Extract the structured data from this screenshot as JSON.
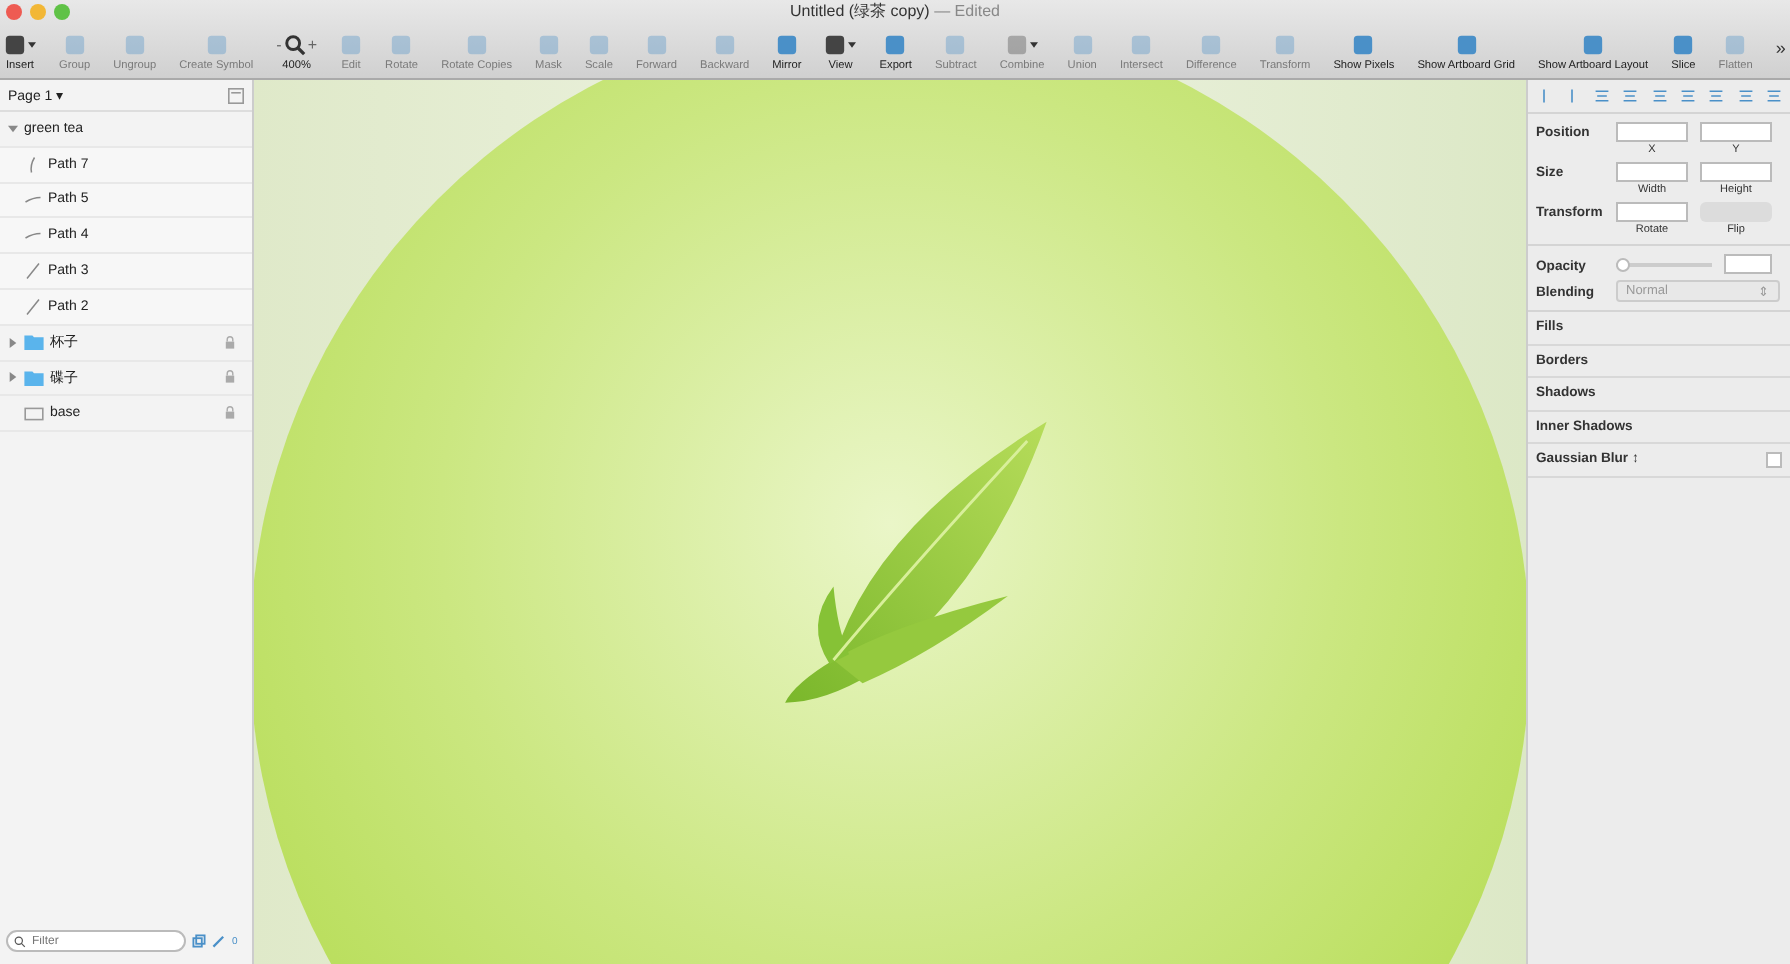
{
  "window": {
    "title": "Untitled (绿茶 copy)",
    "status": "— Edited"
  },
  "toolbar": {
    "items": [
      {
        "label": "Insert",
        "enabled": true,
        "kind": "menu"
      },
      {
        "label": "Group",
        "enabled": false,
        "kind": "tool"
      },
      {
        "label": "Ungroup",
        "enabled": false,
        "kind": "tool"
      },
      {
        "label": "Create Symbol",
        "enabled": false,
        "kind": "tool"
      },
      {
        "label": "400%",
        "enabled": true,
        "kind": "zoom"
      },
      {
        "label": "Edit",
        "enabled": false,
        "kind": "tool"
      },
      {
        "label": "Rotate",
        "enabled": false,
        "kind": "tool"
      },
      {
        "label": "Rotate Copies",
        "enabled": false,
        "kind": "tool"
      },
      {
        "label": "Mask",
        "enabled": false,
        "kind": "tool"
      },
      {
        "label": "Scale",
        "enabled": false,
        "kind": "tool"
      },
      {
        "label": "Forward",
        "enabled": false,
        "kind": "tool"
      },
      {
        "label": "Backward",
        "enabled": false,
        "kind": "tool"
      },
      {
        "label": "Mirror",
        "enabled": true,
        "kind": "tool"
      },
      {
        "label": "View",
        "enabled": true,
        "kind": "menu"
      },
      {
        "label": "Export",
        "enabled": true,
        "kind": "tool"
      },
      {
        "label": "Subtract",
        "enabled": false,
        "kind": "tool"
      },
      {
        "label": "Combine",
        "enabled": false,
        "kind": "menu"
      },
      {
        "label": "Union",
        "enabled": false,
        "kind": "tool"
      },
      {
        "label": "Intersect",
        "enabled": false,
        "kind": "tool"
      },
      {
        "label": "Difference",
        "enabled": false,
        "kind": "tool"
      },
      {
        "label": "Transform",
        "enabled": false,
        "kind": "tool"
      },
      {
        "label": "Show Pixels",
        "enabled": true,
        "kind": "tool"
      },
      {
        "label": "Show Artboard Grid",
        "enabled": true,
        "kind": "tool"
      },
      {
        "label": "Show Artboard Layout",
        "enabled": true,
        "kind": "tool"
      },
      {
        "label": "Slice",
        "enabled": true,
        "kind": "tool"
      },
      {
        "label": "Flatten",
        "enabled": false,
        "kind": "tool"
      }
    ],
    "zoom_minus": "-",
    "zoom_plus": "+",
    "overflow": "»"
  },
  "sidebar": {
    "page": "Page 1",
    "page_caret": "▾",
    "layers": [
      {
        "name": "green tea",
        "kind": "group",
        "expanded": true,
        "locked": false,
        "children": [
          {
            "name": "Path 7",
            "kind": "path",
            "locked": false
          },
          {
            "name": "Path 5",
            "kind": "path",
            "locked": false
          },
          {
            "name": "Path 4",
            "kind": "path",
            "locked": false
          },
          {
            "name": "Path 3",
            "kind": "path",
            "locked": false
          },
          {
            "name": "Path 2",
            "kind": "path",
            "locked": false
          }
        ]
      },
      {
        "name": "杯子",
        "kind": "folder",
        "expanded": false,
        "locked": true
      },
      {
        "name": "碟子",
        "kind": "folder",
        "expanded": false,
        "locked": true
      },
      {
        "name": "base",
        "kind": "shape",
        "locked": true
      }
    ],
    "filter": {
      "placeholder": "Filter"
    },
    "count": "0"
  },
  "inspector": {
    "position": {
      "label": "Position",
      "fields": [
        "X",
        "Y"
      ]
    },
    "size": {
      "label": "Size",
      "fields": [
        "Width",
        "Height"
      ]
    },
    "transform": {
      "label": "Transform",
      "rotate": "Rotate",
      "flip": "Flip"
    },
    "opacity": {
      "label": "Opacity",
      "level": 0
    },
    "blending": {
      "label": "Blending",
      "value": "Normal",
      "arrows": "⇕"
    },
    "sections": [
      {
        "label": "Fills"
      },
      {
        "label": "Borders"
      },
      {
        "label": "Shadows"
      },
      {
        "label": "Inner Shadows"
      },
      {
        "label": "Gaussian Blur ↕",
        "checked": false
      }
    ]
  }
}
